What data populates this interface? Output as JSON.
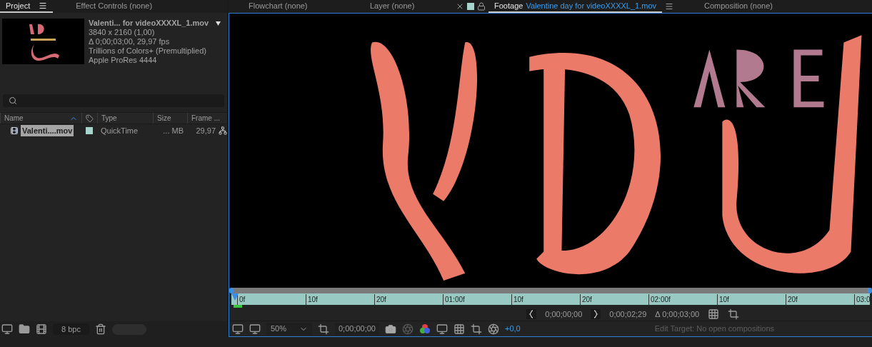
{
  "project_panel": {
    "tabs": [
      {
        "label": "Project",
        "selected": true
      },
      {
        "label": "Effect Controls (none)",
        "selected": false
      }
    ],
    "footage_info": {
      "name": "Valenti... for videoXXXXL_1.mov",
      "lines": [
        "3840 x 2160 (1,00)",
        "Δ 0;00;03;00, 29,97 fps",
        "Trillions of Colors+ (Premultiplied)",
        "Apple ProRes 4444"
      ]
    },
    "columns": [
      {
        "label": "Name",
        "sorted": true
      },
      {
        "kind": "label-tag"
      },
      {
        "label": "Type"
      },
      {
        "label": "Size"
      },
      {
        "label": "Frame ..."
      }
    ],
    "rows": [
      {
        "name": "Valenti....mov",
        "color": "#a8d5cb",
        "type": "QuickTime",
        "size": "... MB",
        "frame_rate": "29,97",
        "selected": true
      }
    ],
    "footer": {
      "bpc": "8 bpc"
    }
  },
  "viewer_panel": {
    "tabs": [
      {
        "label": "Flowchart (none)",
        "selected": false
      },
      {
        "label": "Layer (none)",
        "selected": false
      },
      {
        "label": "Footage",
        "file": "Valentine day for videoXXXXL_1.mov",
        "selected": true
      },
      {
        "label": "Composition (none)",
        "selected": false
      }
    ],
    "ruler": [
      "0f",
      "10f",
      "20f",
      "01:00f",
      "10f",
      "20f",
      "02:00f",
      "10f",
      "20f",
      "03:0"
    ],
    "in_point": "0;00;00;00",
    "out_point": "0;00;02;29",
    "duration": "Δ 0;00;03;00",
    "toolbar": {
      "zoom": "50%",
      "timecode": "0;00;00;00",
      "exposure": "+0,0",
      "edit_target": "Edit Target: No open compositions"
    }
  }
}
